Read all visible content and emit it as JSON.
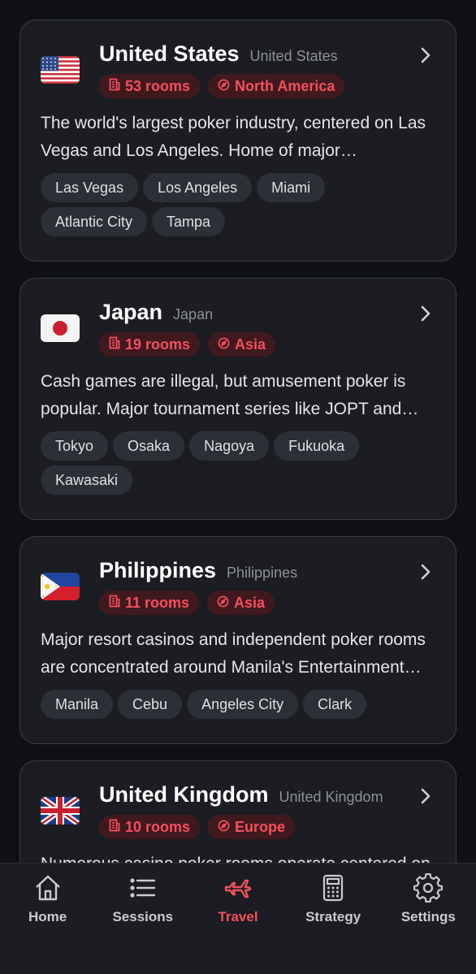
{
  "colors": {
    "accent": "#f2505d",
    "badge_bg": "#40191f",
    "card_bg": "#1b1d22",
    "page_bg": "#0f1115"
  },
  "countries": [
    {
      "flag_icon": "us-flag-icon",
      "name": "United States",
      "subname": "United States",
      "rooms": "53 rooms",
      "region": "North America",
      "description": "The world's largest poker industry, centered on Las Vegas and Los Angeles. Home of major tournaments",
      "cities": [
        "Las Vegas",
        "Los Angeles",
        "Miami",
        "Atlantic City",
        "Tampa"
      ]
    },
    {
      "flag_icon": "japan-flag-icon",
      "name": "Japan",
      "subname": "Japan",
      "rooms": "19 rooms",
      "region": "Asia",
      "description": "Cash games are illegal, but amusement poker is popular. Major tournament series like JOPT and more",
      "cities": [
        "Tokyo",
        "Osaka",
        "Nagoya",
        "Fukuoka",
        "Kawasaki"
      ]
    },
    {
      "flag_icon": "philippines-flag-icon",
      "name": "Philippines",
      "subname": "Philippines",
      "rooms": "11 rooms",
      "region": "Asia",
      "description": "Major resort casinos and independent poker rooms are concentrated around Manila's Entertainment City",
      "cities": [
        "Manila",
        "Cebu",
        "Angeles City",
        "Clark"
      ]
    },
    {
      "flag_icon": "uk-flag-icon",
      "name": "United Kingdom",
      "subname": "United Kingdom",
      "rooms": "10 rooms",
      "region": "Europe",
      "description": "Numerous casino poker rooms operate centered on London. A major European tournament",
      "cities": []
    }
  ],
  "tabbar": [
    {
      "label": "Home",
      "icon": "home-icon",
      "active": false
    },
    {
      "label": "Sessions",
      "icon": "list-icon",
      "active": false
    },
    {
      "label": "Travel",
      "icon": "airplane-icon",
      "active": true
    },
    {
      "label": "Strategy",
      "icon": "calculator-icon",
      "active": false
    },
    {
      "label": "Settings",
      "icon": "gear-icon",
      "active": false
    }
  ]
}
